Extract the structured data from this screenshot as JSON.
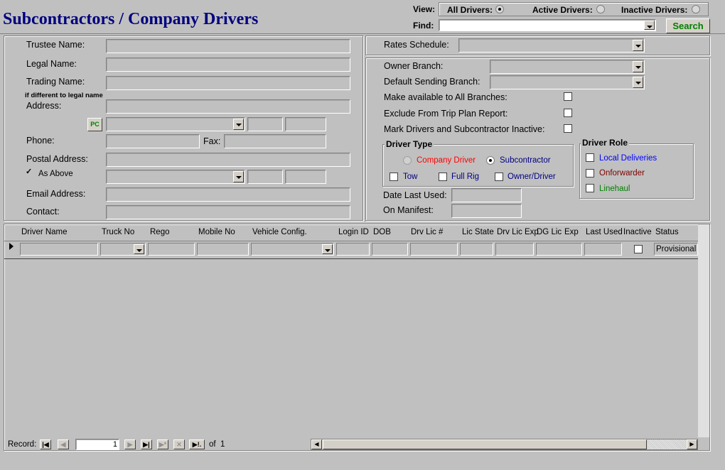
{
  "header": {
    "title": "Subcontractors / Company Drivers",
    "view_label": "View:",
    "view_all": "All Drivers:",
    "view_active": "Active Drivers:",
    "view_inactive": "Inactive Drivers:",
    "find_label": "Find:",
    "find_value": "",
    "search_label": "Search"
  },
  "left": {
    "trustee_name": "Trustee Name:",
    "legal_name": "Legal Name:",
    "trading_name": "Trading Name:",
    "trading_note": "if different to legal name",
    "address": "Address:",
    "pc_label": "PC",
    "phone": "Phone:",
    "fax": "Fax:",
    "postal_address": "Postal Address:",
    "as_above": "As Above",
    "email": "Email Address:",
    "contact": "Contact:"
  },
  "right": {
    "rates_schedule": "Rates Schedule:",
    "owner_branch": "Owner Branch:",
    "default_sending_branch": "Default Sending Branch:",
    "all_branches": "Make available to All Branches:",
    "exclude_trip": "Exclude From Trip Plan Report:",
    "mark_inactive": "Mark Drivers and Subcontractor Inactive:",
    "driver_type": {
      "title": "Driver Type",
      "company_driver": "Company Driver",
      "subcontractor": "Subcontractor",
      "tow": "Tow",
      "full_rig": "Full Rig",
      "owner_driver": "Owner/Driver"
    },
    "driver_role": {
      "title": "Driver Role",
      "local_deliveries": "Local Deliveries",
      "onforwarder": "Onforwarder",
      "linehaul": "Linehaul"
    },
    "date_last_used": "Date Last Used:",
    "on_manifest": "On Manifest:"
  },
  "grid": {
    "columns": [
      "Driver Name",
      "Truck No",
      "Rego",
      "Mobile No",
      "Vehicle Config.",
      "Login ID",
      "DOB",
      "Drv Lic #",
      "Lic State",
      "Drv Lic Exp",
      "DG Lic",
      "Exp",
      "Last Used",
      "Inactive",
      "Status"
    ],
    "row_status": "Provisional"
  },
  "nav": {
    "record_label": "Record:",
    "current": "1",
    "of_label": "of",
    "total": "1"
  },
  "colors": {
    "title": "#000080",
    "company_driver": "#ff0000",
    "subcontractor": "#000080",
    "local_deliveries": "#0000ff",
    "onforwarder": "#800000",
    "linehaul": "#008000",
    "search": "#008000"
  }
}
